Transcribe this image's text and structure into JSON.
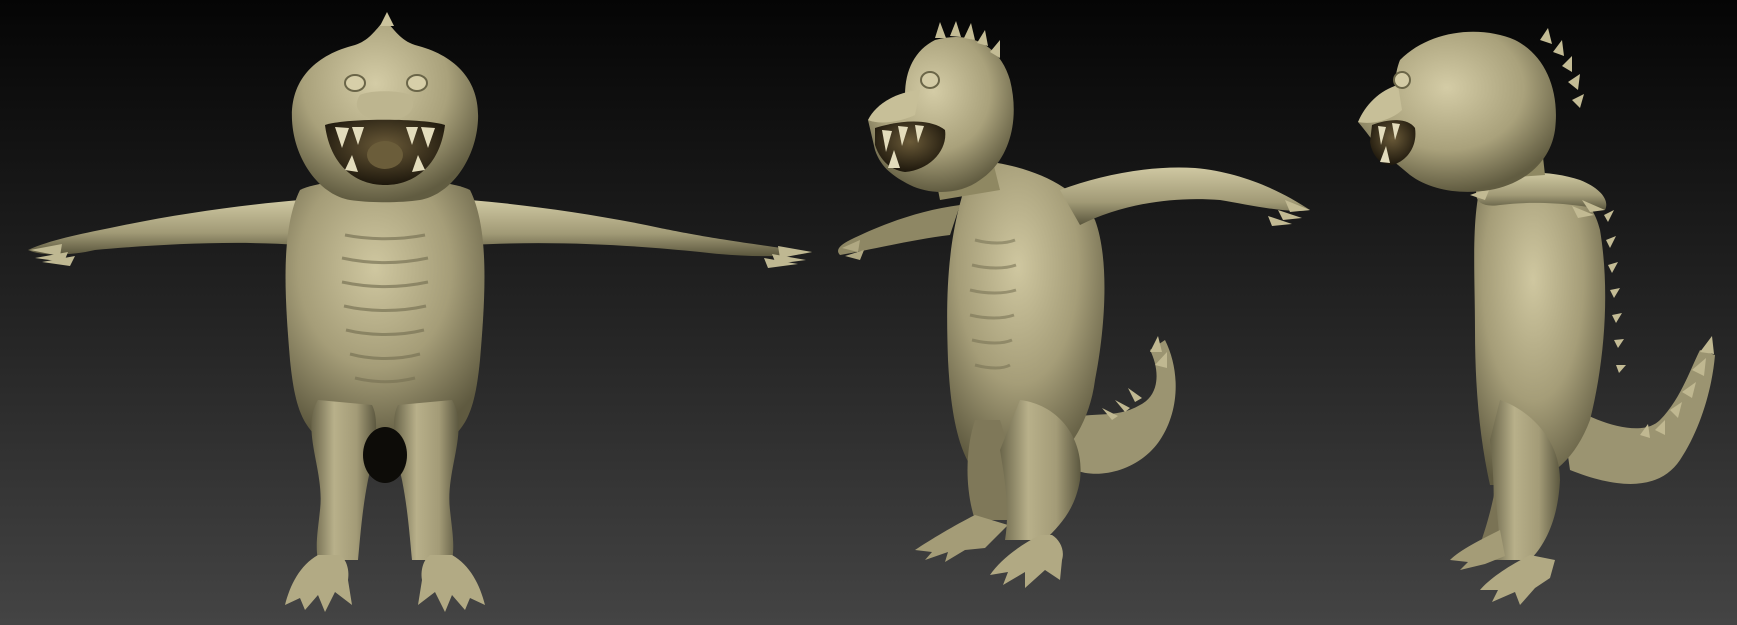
{
  "scene": {
    "views": [
      {
        "id": "front",
        "name": "front-view"
      },
      {
        "id": "three-quarter",
        "name": "three-quarter-view"
      },
      {
        "id": "side",
        "name": "side-view"
      }
    ]
  },
  "colors": {
    "background_top": "#050505",
    "background_bottom": "#444444",
    "clay_light": "#c9c19a",
    "clay_mid": "#a39c78",
    "clay_dark": "#6e6a4e",
    "clay_shadow": "#3d3a2a",
    "mouth": "#2a2416",
    "teeth": "#e6dfc0"
  }
}
